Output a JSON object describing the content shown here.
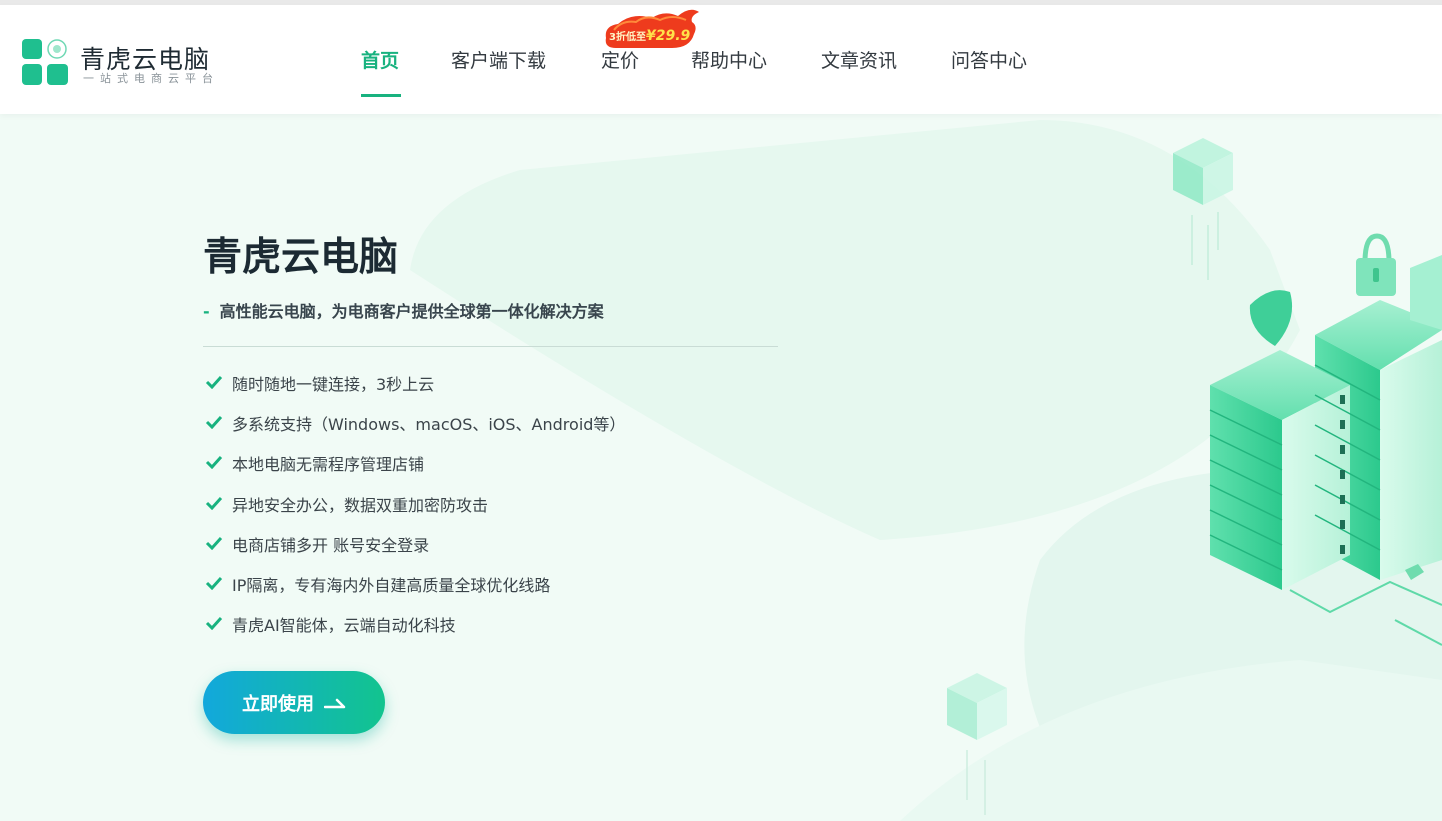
{
  "brand": {
    "name": "青虎云电脑",
    "tagline": "一站式电商云平台",
    "primary_color": "#18b27f"
  },
  "nav": {
    "items": [
      {
        "label": "首页",
        "active": true
      },
      {
        "label": "客户端下载",
        "active": false
      },
      {
        "label": "定价",
        "active": false
      },
      {
        "label": "帮助中心",
        "active": false
      },
      {
        "label": "文章资讯",
        "active": false
      },
      {
        "label": "问答中心",
        "active": false
      }
    ],
    "promo_badge": {
      "prefix": "3折低至",
      "price": "¥29.9"
    }
  },
  "hero": {
    "title": "青虎云电脑",
    "subtitle_dash": "-",
    "subtitle": "高性能云电脑，为电商客户提供全球第一体化解决方案",
    "features": [
      "随时随地一键连接，3秒上云",
      "多系统支持（Windows、macOS、iOS、Android等）",
      "本地电脑无需程序管理店铺",
      "异地安全办公，数据双重加密防攻击",
      "电商店铺多开 账号安全登录",
      "IP隔离，专有海内外自建高质量全球优化线路",
      "青虎AI智能体，云端自动化科技"
    ],
    "cta_label": "立即使用",
    "illustration": "server-racks-illustration"
  }
}
